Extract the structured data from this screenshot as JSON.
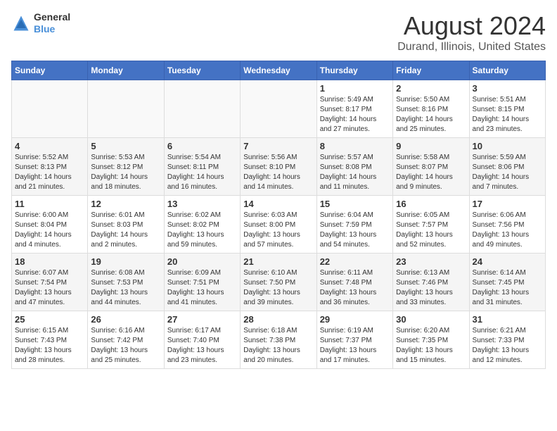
{
  "logo": {
    "text1": "General",
    "text2": "Blue"
  },
  "title": "August 2024",
  "subtitle": "Durand, Illinois, United States",
  "days_of_week": [
    "Sunday",
    "Monday",
    "Tuesday",
    "Wednesday",
    "Thursday",
    "Friday",
    "Saturday"
  ],
  "weeks": [
    [
      {
        "day": "",
        "content": ""
      },
      {
        "day": "",
        "content": ""
      },
      {
        "day": "",
        "content": ""
      },
      {
        "day": "",
        "content": ""
      },
      {
        "day": "1",
        "content": "Sunrise: 5:49 AM\nSunset: 8:17 PM\nDaylight: 14 hours\nand 27 minutes."
      },
      {
        "day": "2",
        "content": "Sunrise: 5:50 AM\nSunset: 8:16 PM\nDaylight: 14 hours\nand 25 minutes."
      },
      {
        "day": "3",
        "content": "Sunrise: 5:51 AM\nSunset: 8:15 PM\nDaylight: 14 hours\nand 23 minutes."
      }
    ],
    [
      {
        "day": "4",
        "content": "Sunrise: 5:52 AM\nSunset: 8:13 PM\nDaylight: 14 hours\nand 21 minutes."
      },
      {
        "day": "5",
        "content": "Sunrise: 5:53 AM\nSunset: 8:12 PM\nDaylight: 14 hours\nand 18 minutes."
      },
      {
        "day": "6",
        "content": "Sunrise: 5:54 AM\nSunset: 8:11 PM\nDaylight: 14 hours\nand 16 minutes."
      },
      {
        "day": "7",
        "content": "Sunrise: 5:56 AM\nSunset: 8:10 PM\nDaylight: 14 hours\nand 14 minutes."
      },
      {
        "day": "8",
        "content": "Sunrise: 5:57 AM\nSunset: 8:08 PM\nDaylight: 14 hours\nand 11 minutes."
      },
      {
        "day": "9",
        "content": "Sunrise: 5:58 AM\nSunset: 8:07 PM\nDaylight: 14 hours\nand 9 minutes."
      },
      {
        "day": "10",
        "content": "Sunrise: 5:59 AM\nSunset: 8:06 PM\nDaylight: 14 hours\nand 7 minutes."
      }
    ],
    [
      {
        "day": "11",
        "content": "Sunrise: 6:00 AM\nSunset: 8:04 PM\nDaylight: 14 hours\nand 4 minutes."
      },
      {
        "day": "12",
        "content": "Sunrise: 6:01 AM\nSunset: 8:03 PM\nDaylight: 14 hours\nand 2 minutes."
      },
      {
        "day": "13",
        "content": "Sunrise: 6:02 AM\nSunset: 8:02 PM\nDaylight: 13 hours\nand 59 minutes."
      },
      {
        "day": "14",
        "content": "Sunrise: 6:03 AM\nSunset: 8:00 PM\nDaylight: 13 hours\nand 57 minutes."
      },
      {
        "day": "15",
        "content": "Sunrise: 6:04 AM\nSunset: 7:59 PM\nDaylight: 13 hours\nand 54 minutes."
      },
      {
        "day": "16",
        "content": "Sunrise: 6:05 AM\nSunset: 7:57 PM\nDaylight: 13 hours\nand 52 minutes."
      },
      {
        "day": "17",
        "content": "Sunrise: 6:06 AM\nSunset: 7:56 PM\nDaylight: 13 hours\nand 49 minutes."
      }
    ],
    [
      {
        "day": "18",
        "content": "Sunrise: 6:07 AM\nSunset: 7:54 PM\nDaylight: 13 hours\nand 47 minutes."
      },
      {
        "day": "19",
        "content": "Sunrise: 6:08 AM\nSunset: 7:53 PM\nDaylight: 13 hours\nand 44 minutes."
      },
      {
        "day": "20",
        "content": "Sunrise: 6:09 AM\nSunset: 7:51 PM\nDaylight: 13 hours\nand 41 minutes."
      },
      {
        "day": "21",
        "content": "Sunrise: 6:10 AM\nSunset: 7:50 PM\nDaylight: 13 hours\nand 39 minutes."
      },
      {
        "day": "22",
        "content": "Sunrise: 6:11 AM\nSunset: 7:48 PM\nDaylight: 13 hours\nand 36 minutes."
      },
      {
        "day": "23",
        "content": "Sunrise: 6:13 AM\nSunset: 7:46 PM\nDaylight: 13 hours\nand 33 minutes."
      },
      {
        "day": "24",
        "content": "Sunrise: 6:14 AM\nSunset: 7:45 PM\nDaylight: 13 hours\nand 31 minutes."
      }
    ],
    [
      {
        "day": "25",
        "content": "Sunrise: 6:15 AM\nSunset: 7:43 PM\nDaylight: 13 hours\nand 28 minutes."
      },
      {
        "day": "26",
        "content": "Sunrise: 6:16 AM\nSunset: 7:42 PM\nDaylight: 13 hours\nand 25 minutes."
      },
      {
        "day": "27",
        "content": "Sunrise: 6:17 AM\nSunset: 7:40 PM\nDaylight: 13 hours\nand 23 minutes."
      },
      {
        "day": "28",
        "content": "Sunrise: 6:18 AM\nSunset: 7:38 PM\nDaylight: 13 hours\nand 20 minutes."
      },
      {
        "day": "29",
        "content": "Sunrise: 6:19 AM\nSunset: 7:37 PM\nDaylight: 13 hours\nand 17 minutes."
      },
      {
        "day": "30",
        "content": "Sunrise: 6:20 AM\nSunset: 7:35 PM\nDaylight: 13 hours\nand 15 minutes."
      },
      {
        "day": "31",
        "content": "Sunrise: 6:21 AM\nSunset: 7:33 PM\nDaylight: 13 hours\nand 12 minutes."
      }
    ]
  ]
}
